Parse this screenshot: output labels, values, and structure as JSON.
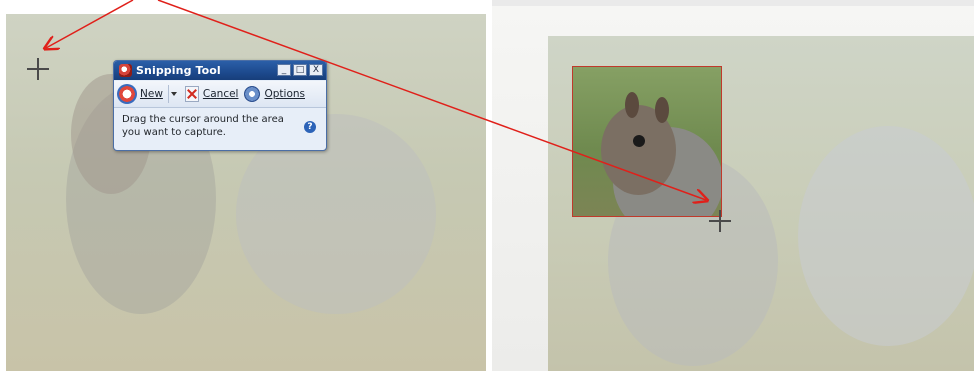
{
  "snipping_tool": {
    "title": "Snipping Tool",
    "controls": {
      "minimize": "_",
      "maximize": "□",
      "close": "X"
    },
    "toolbar": {
      "new_label": "New",
      "cancel_label": "Cancel",
      "options_label": "Options"
    },
    "instruction": "Drag the cursor around the area you want to capture.",
    "help_icon": "?"
  },
  "icons": {
    "app": "scissors-icon",
    "new": "new-snip-icon",
    "cancel": "cancel-icon",
    "options": "options-icon",
    "help": "help-icon",
    "cursor": "crosshair-cursor-icon"
  },
  "colors": {
    "annotation_arrow": "#e0201a",
    "title_bar": "#1d4a8e",
    "selection_border": "#c0392b"
  }
}
